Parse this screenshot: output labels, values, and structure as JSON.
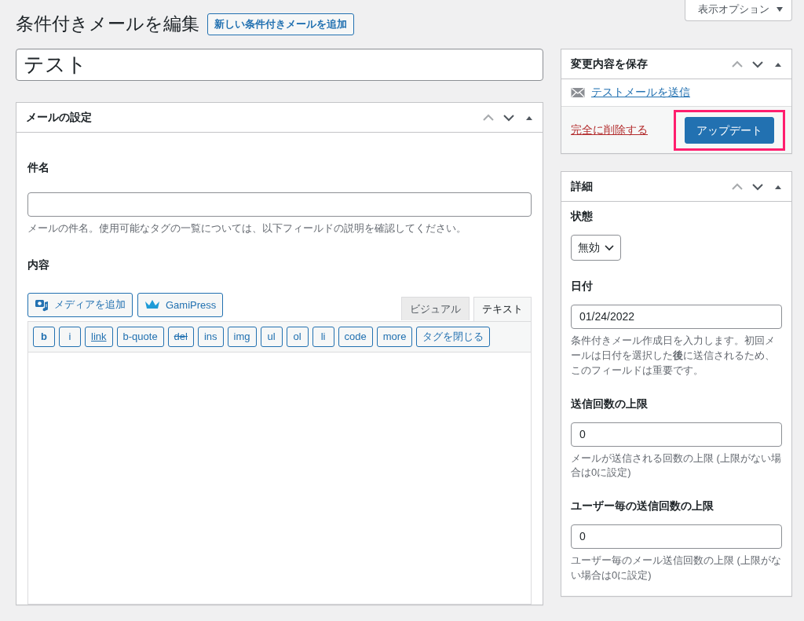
{
  "header": {
    "title": "条件付きメールを編集",
    "add_new_button": "新しい条件付きメールを追加",
    "screen_options": "表示オプション"
  },
  "post_title": {
    "value": "テスト"
  },
  "mail_settings": {
    "title": "メールの設定",
    "subject": {
      "label": "件名",
      "description": "メールの件名。使用可能なタグの一覧については、以下フィールドの説明を確認してください。"
    },
    "content": {
      "label": "内容",
      "media_buttons": [
        {
          "label": "メディアを追加",
          "kind": "media"
        },
        {
          "label": "GamiPress",
          "kind": "crown"
        }
      ],
      "editor_tabs": [
        {
          "label": "ビジュアル",
          "selected": false
        },
        {
          "label": "テキスト",
          "selected": true
        }
      ],
      "quicktags": [
        {
          "label": "b",
          "kind": "bold"
        },
        {
          "label": "i",
          "kind": "plain"
        },
        {
          "label": "link",
          "kind": "link"
        },
        {
          "label": "b-quote",
          "kind": "plain"
        },
        {
          "label": "del",
          "kind": "strike"
        },
        {
          "label": "ins",
          "kind": "plain"
        },
        {
          "label": "img",
          "kind": "plain"
        },
        {
          "label": "ul",
          "kind": "plain"
        },
        {
          "label": "ol",
          "kind": "plain"
        },
        {
          "label": "li",
          "kind": "plain"
        },
        {
          "label": "code",
          "kind": "plain"
        },
        {
          "label": "more",
          "kind": "plain"
        },
        {
          "label": "タグを閉じる",
          "kind": "plain"
        }
      ]
    }
  },
  "publish": {
    "title": "変更内容を保存",
    "send_test_link": "テストメールを送信",
    "delete_link": "完全に削除する",
    "update_button": {
      "label": "アップデート",
      "highlighted": true
    }
  },
  "details": {
    "title": "詳細",
    "fields": [
      {
        "kind": "select",
        "label": "状態",
        "value": "無効"
      },
      {
        "kind": "text",
        "label": "日付",
        "value": "01/24/2022",
        "description": "条件付きメール作成日を入力します。初回メールは日付を選択した**後**に送信されるため、このフィールドは重要です。"
      },
      {
        "kind": "text",
        "label": "送信回数の上限",
        "value": "0",
        "description": "メールが送信される回数の上限 (上限がない場合は0に設定)"
      },
      {
        "kind": "text",
        "label": "ユーザー毎の送信回数の上限",
        "value": "0",
        "description": "ユーザー毎のメール送信回数の上限 (上限がない場合は0に設定)"
      }
    ]
  }
}
